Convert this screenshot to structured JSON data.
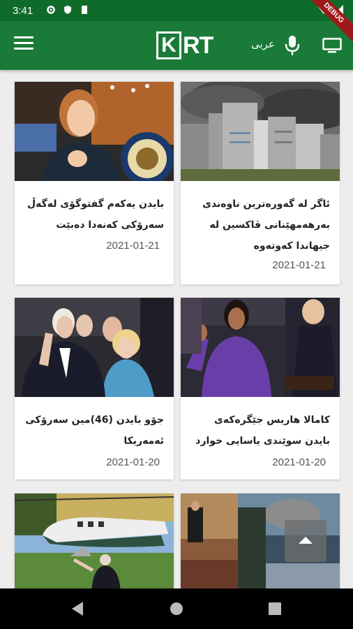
{
  "status_bar": {
    "time": "3:41"
  },
  "debug_banner": "DEBUG",
  "app_bar": {
    "logo_k": "K",
    "logo_rt": "RT",
    "language_link": "عربی",
    "brand_color": "#1a7a37"
  },
  "articles": [
    {
      "title": "ئاگر لە گەورەترین ناوەندی بەرهەمهێنانی ڤاکسین لە جیهاندا کەوتەوە",
      "date": "2021-01-21"
    },
    {
      "title": "بایدن یەکەم گفتوگۆی لەگەڵ سەرۆکی کەنەدا دەبێت",
      "date": "2021-01-21"
    },
    {
      "title": "کامالا هاریس جێگرەکەی بایدن سوێندی یاسایی خوارد",
      "date": "2021-01-20"
    },
    {
      "title": "جۆو بایدن (46)مین سەرۆکی ئەمەریکا",
      "date": "2021-01-20"
    },
    {
      "title": "",
      "date": ""
    },
    {
      "title": "",
      "date": ""
    }
  ]
}
